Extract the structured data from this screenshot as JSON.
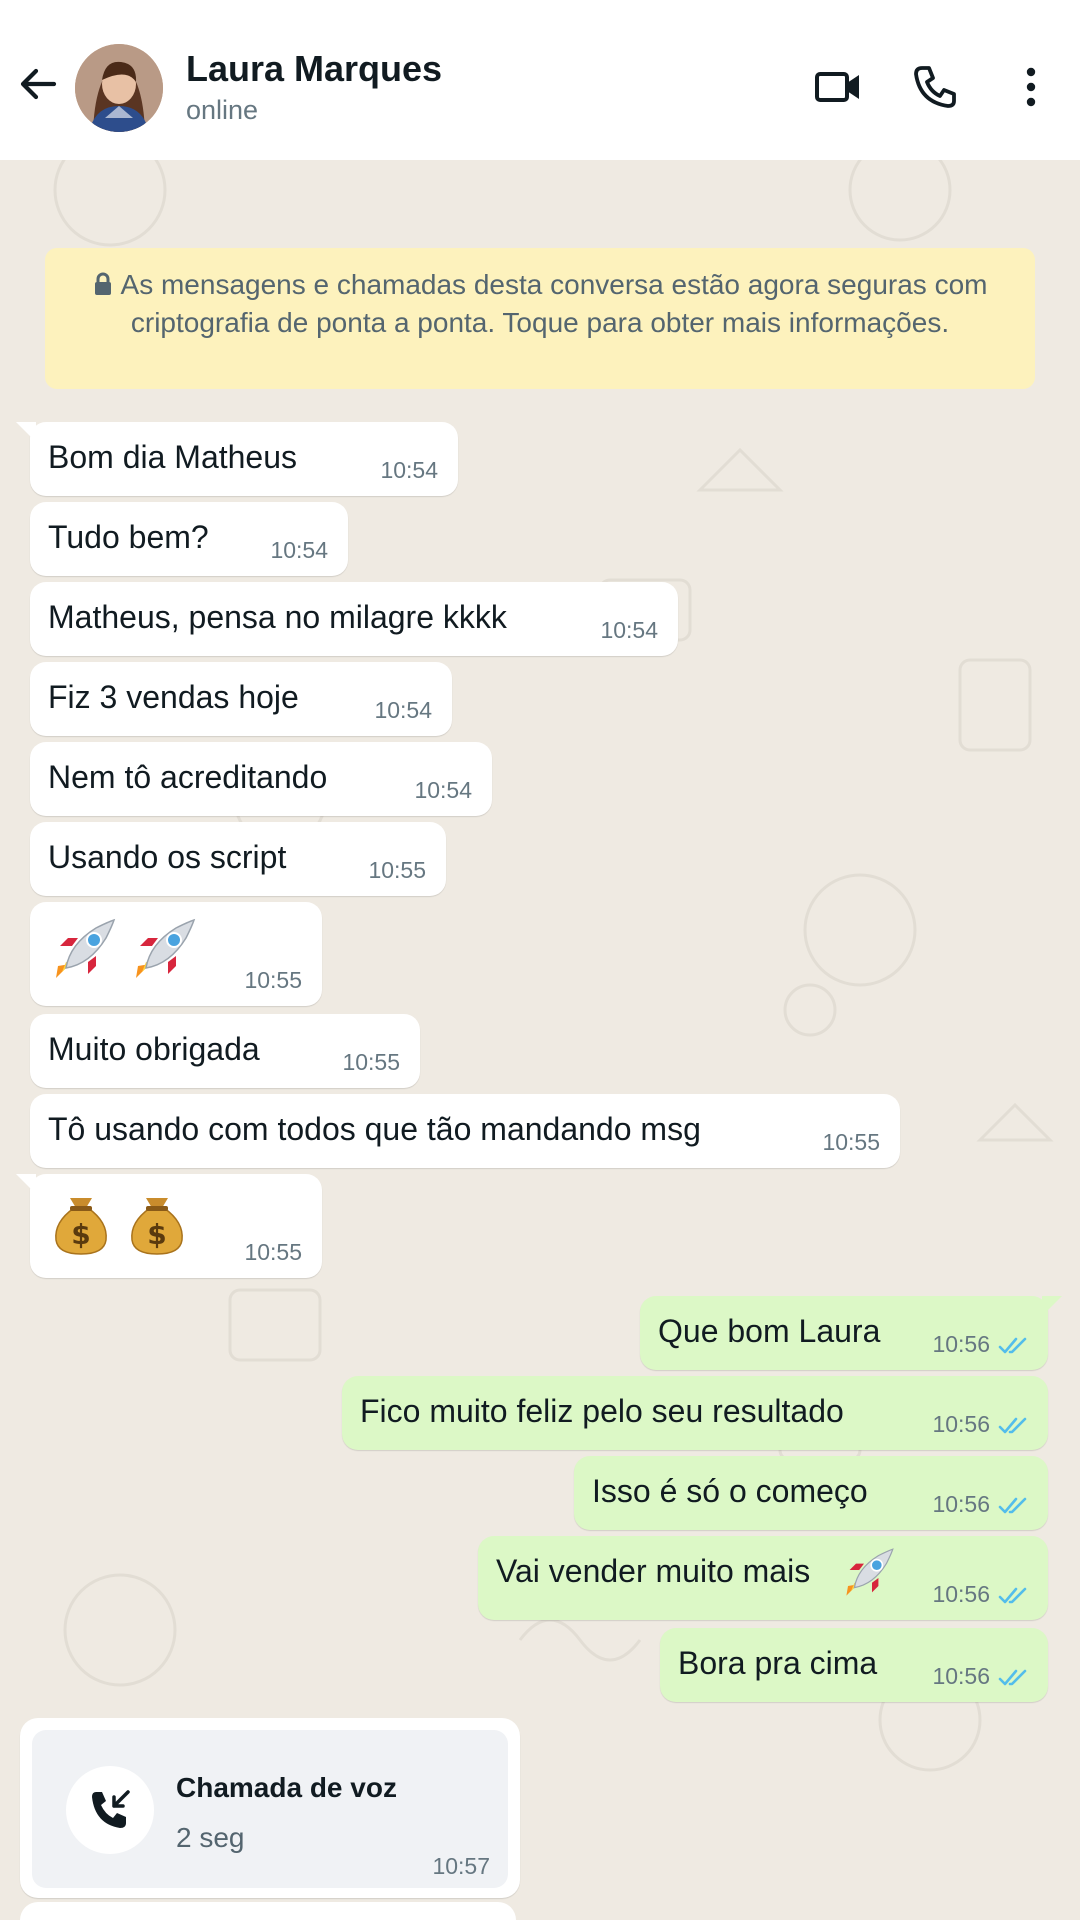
{
  "header": {
    "name": "Laura Marques",
    "status": "online",
    "icons": {
      "back": "arrow-left-icon",
      "video": "video-camera-icon",
      "call": "phone-icon",
      "menu": "more-vertical-icon"
    }
  },
  "notice": {
    "text": "As mensagens e chamadas desta conversa estão agora seguras com criptografia de ponta a ponta. Toque para obter mais informações.",
    "icon": "lock-icon",
    "background": "#fdf2bd"
  },
  "messages": [
    {
      "direction": "in",
      "text": "Bom dia Matheus",
      "time": "10:54"
    },
    {
      "direction": "in",
      "text": "Tudo bem?",
      "time": "10:54"
    },
    {
      "direction": "in",
      "text": "Matheus, pensa no milagre kkkk",
      "time": "10:54"
    },
    {
      "direction": "in",
      "text": "Fiz 3 vendas hoje",
      "time": "10:54"
    },
    {
      "direction": "in",
      "text": "Nem tô acreditando",
      "time": "10:54"
    },
    {
      "direction": "in",
      "text": "Usando os script",
      "time": "10:55"
    },
    {
      "direction": "in",
      "emoji": [
        "rocket",
        "rocket"
      ],
      "time": "10:55"
    },
    {
      "direction": "in",
      "text": "Muito obrigada",
      "time": "10:55"
    },
    {
      "direction": "in",
      "text": "Tô usando com todos que tão mandando msg",
      "time": "10:55"
    },
    {
      "direction": "in",
      "emoji": [
        "money-bag",
        "money-bag"
      ],
      "time": "10:55"
    },
    {
      "direction": "out",
      "text": "Que bom Laura",
      "time": "10:56",
      "status": "read"
    },
    {
      "direction": "out",
      "text": "Fico muito feliz pelo seu resultado",
      "time": "10:56",
      "status": "read"
    },
    {
      "direction": "out",
      "text": "Isso é só o começo",
      "time": "10:56",
      "status": "read"
    },
    {
      "direction": "out",
      "text": "Vai vender muito mais",
      "emoji": [
        "rocket"
      ],
      "time": "10:56",
      "status": "read"
    },
    {
      "direction": "out",
      "text": "Bora pra cima",
      "time": "10:56",
      "status": "read"
    }
  ],
  "voice_call": {
    "title": "Chamada de voz",
    "duration": "2 seg",
    "time": "10:57",
    "icon": "incoming-call-icon"
  },
  "colors": {
    "incoming_bubble": "#ffffff",
    "outgoing_bubble": "#dcf8c6",
    "read_tick": "#53bdeb",
    "chat_background": "#efeae2"
  }
}
